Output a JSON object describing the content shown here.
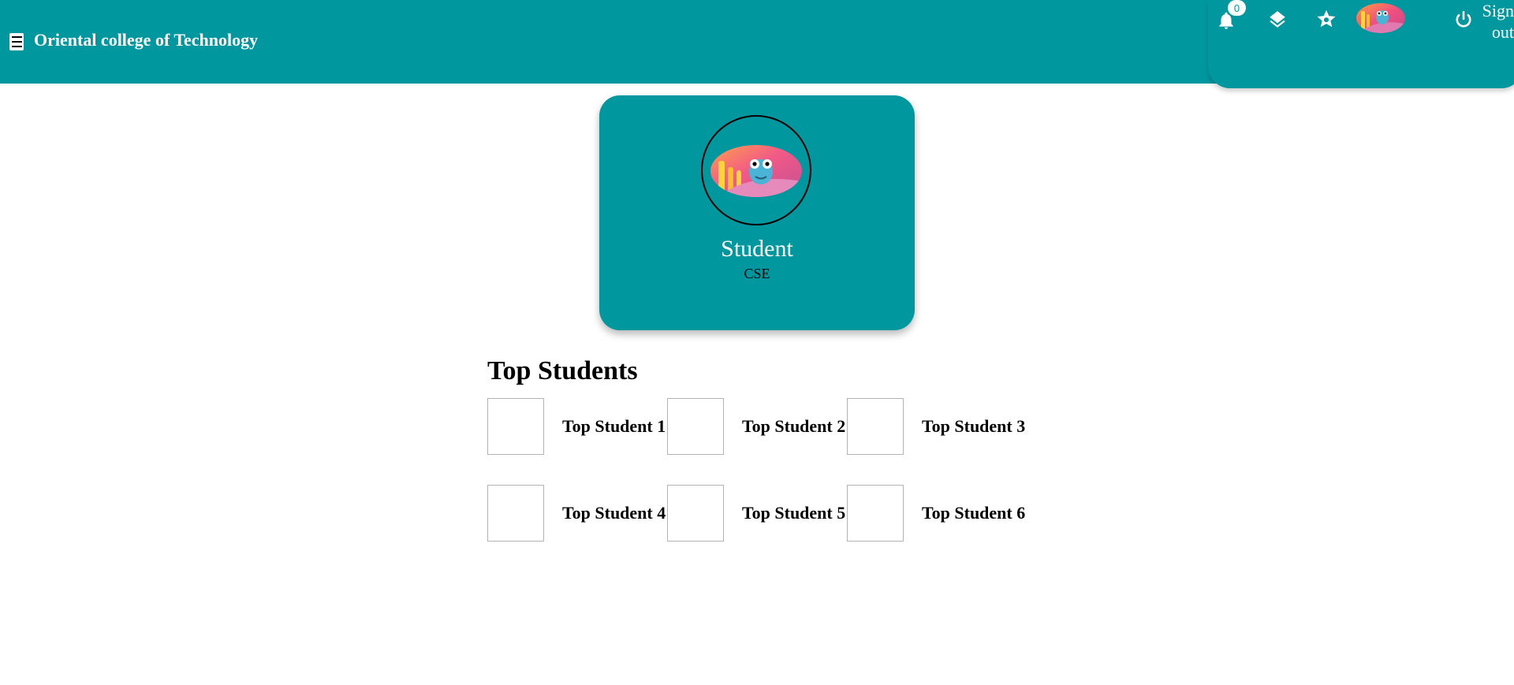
{
  "header": {
    "brand": "Oriental college of Technology",
    "menu_icon": "hamburger-menu-icon",
    "notification_count": "0",
    "icons": [
      "bell-icon",
      "layers-icon",
      "star-icon",
      "avatar",
      "power-icon"
    ],
    "signout_label": "Sign out"
  },
  "profile": {
    "role": "Student",
    "department": "CSE"
  },
  "top_students": {
    "title": "Top Students",
    "items": [
      {
        "name": "Top Student 1"
      },
      {
        "name": "Top Student 2"
      },
      {
        "name": "Top Student 3"
      },
      {
        "name": "Top Student 4"
      },
      {
        "name": "Top Student 5"
      },
      {
        "name": "Top Student 6"
      }
    ]
  },
  "colors": {
    "brand_teal": "#01979f",
    "text_dark": "#000000",
    "text_light": "#ffffff"
  }
}
